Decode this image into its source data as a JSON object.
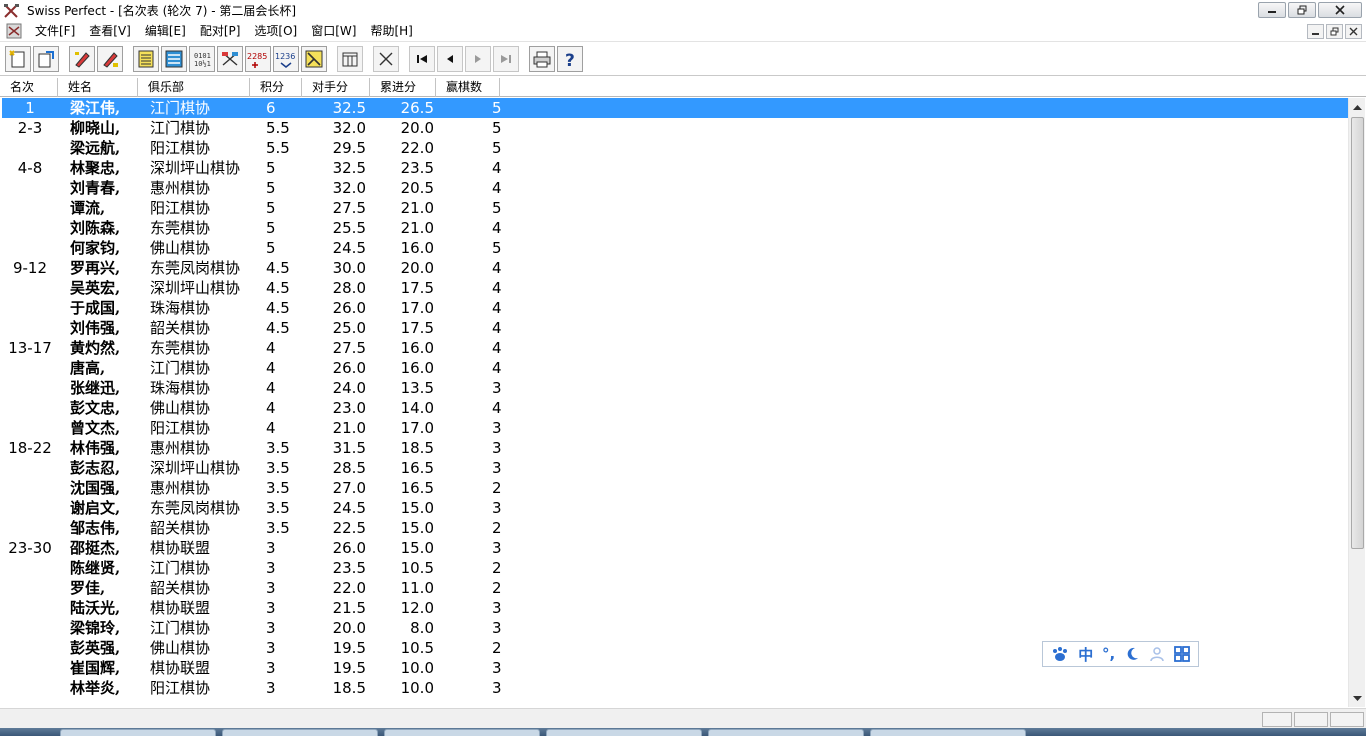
{
  "window": {
    "title": "Swiss Perfect - [名次表  (轮次 7) - 第二届会长杯]"
  },
  "menu": [
    {
      "label": "文件[F]"
    },
    {
      "label": "查看[V]"
    },
    {
      "label": "编辑[E]"
    },
    {
      "label": "配对[P]"
    },
    {
      "label": "选项[O]"
    },
    {
      "label": "窗口[W]"
    },
    {
      "label": "帮助[H]"
    }
  ],
  "toolbar": {
    "icons": [
      "new-file-icon",
      "open-file-icon",
      "pencil-icon",
      "pencil-alt-icon",
      "list-icon",
      "columns-icon",
      "binary-icon",
      "flags-icon",
      "number-2285-icon",
      "number-1236-icon",
      "puzzle-icon",
      "table-icon",
      "cross-pairing-icon",
      "first-round-icon",
      "prev-round-icon",
      "next-round-icon",
      "last-round-icon",
      "print-icon",
      "help-icon"
    ],
    "num_a": "2285",
    "num_b": "1236"
  },
  "columns": {
    "rank": "名次",
    "name": "姓名",
    "club": "俱乐部",
    "points": "积分",
    "opponent": "对手分",
    "cumulative": "累进分",
    "wins": "赢棋数"
  },
  "rows": [
    {
      "rank": "1",
      "name": "梁江伟,",
      "club": "江门棋协",
      "points": "6",
      "opp": "32.5",
      "cum": "26.5",
      "wins": "5"
    },
    {
      "rank": "2-3",
      "name": "柳晓山,",
      "club": "江门棋协",
      "points": "5.5",
      "opp": "32.0",
      "cum": "20.0",
      "wins": "5"
    },
    {
      "rank": "",
      "name": "梁远航,",
      "club": "阳江棋协",
      "points": "5.5",
      "opp": "29.5",
      "cum": "22.0",
      "wins": "5"
    },
    {
      "rank": "4-8",
      "name": "林聚忠,",
      "club": "深圳坪山棋协",
      "points": "5",
      "opp": "32.5",
      "cum": "23.5",
      "wins": "4"
    },
    {
      "rank": "",
      "name": "刘青春,",
      "club": "惠州棋协",
      "points": "5",
      "opp": "32.0",
      "cum": "20.5",
      "wins": "4"
    },
    {
      "rank": "",
      "name": "谭流,",
      "club": "阳江棋协",
      "points": "5",
      "opp": "27.5",
      "cum": "21.0",
      "wins": "5"
    },
    {
      "rank": "",
      "name": "刘陈森,",
      "club": "东莞棋协",
      "points": "5",
      "opp": "25.5",
      "cum": "21.0",
      "wins": "4"
    },
    {
      "rank": "",
      "name": "何家钧,",
      "club": "佛山棋协",
      "points": "5",
      "opp": "24.5",
      "cum": "16.0",
      "wins": "5"
    },
    {
      "rank": "9-12",
      "name": "罗再兴,",
      "club": "东莞凤岗棋协",
      "points": "4.5",
      "opp": "30.0",
      "cum": "20.0",
      "wins": "4"
    },
    {
      "rank": "",
      "name": "吴英宏,",
      "club": "深圳坪山棋协",
      "points": "4.5",
      "opp": "28.0",
      "cum": "17.5",
      "wins": "4"
    },
    {
      "rank": "",
      "name": "于成国,",
      "club": "珠海棋协",
      "points": "4.5",
      "opp": "26.0",
      "cum": "17.0",
      "wins": "4"
    },
    {
      "rank": "",
      "name": "刘伟强,",
      "club": "韶关棋协",
      "points": "4.5",
      "opp": "25.0",
      "cum": "17.5",
      "wins": "4"
    },
    {
      "rank": "13-17",
      "name": "黄灼然,",
      "club": "东莞棋协",
      "points": "4",
      "opp": "27.5",
      "cum": "16.0",
      "wins": "4"
    },
    {
      "rank": "",
      "name": "唐高,",
      "club": "江门棋协",
      "points": "4",
      "opp": "26.0",
      "cum": "16.0",
      "wins": "4"
    },
    {
      "rank": "",
      "name": "张继迅,",
      "club": "珠海棋协",
      "points": "4",
      "opp": "24.0",
      "cum": "13.5",
      "wins": "3"
    },
    {
      "rank": "",
      "name": "彭文忠,",
      "club": "佛山棋协",
      "points": "4",
      "opp": "23.0",
      "cum": "14.0",
      "wins": "4"
    },
    {
      "rank": "",
      "name": "曾文杰,",
      "club": "阳江棋协",
      "points": "4",
      "opp": "21.0",
      "cum": "17.0",
      "wins": "3"
    },
    {
      "rank": "18-22",
      "name": "林伟强,",
      "club": "惠州棋协",
      "points": "3.5",
      "opp": "31.5",
      "cum": "18.5",
      "wins": "3"
    },
    {
      "rank": "",
      "name": "彭志忍,",
      "club": "深圳坪山棋协",
      "points": "3.5",
      "opp": "28.5",
      "cum": "16.5",
      "wins": "3"
    },
    {
      "rank": "",
      "name": "沈国强,",
      "club": "惠州棋协",
      "points": "3.5",
      "opp": "27.0",
      "cum": "16.5",
      "wins": "2"
    },
    {
      "rank": "",
      "name": "谢启文,",
      "club": "东莞凤岗棋协",
      "points": "3.5",
      "opp": "24.5",
      "cum": "15.0",
      "wins": "3"
    },
    {
      "rank": "",
      "name": "邹志伟,",
      "club": "韶关棋协",
      "points": "3.5",
      "opp": "22.5",
      "cum": "15.0",
      "wins": "2"
    },
    {
      "rank": "23-30",
      "name": "邵挺杰,",
      "club": "棋协联盟",
      "points": "3",
      "opp": "26.0",
      "cum": "15.0",
      "wins": "3"
    },
    {
      "rank": "",
      "name": "陈继贤,",
      "club": "江门棋协",
      "points": "3",
      "opp": "23.5",
      "cum": "10.5",
      "wins": "2"
    },
    {
      "rank": "",
      "name": "罗佳,",
      "club": "韶关棋协",
      "points": "3",
      "opp": "22.0",
      "cum": "11.0",
      "wins": "2"
    },
    {
      "rank": "",
      "name": "陆沃光,",
      "club": "棋协联盟",
      "points": "3",
      "opp": "21.5",
      "cum": "12.0",
      "wins": "3"
    },
    {
      "rank": "",
      "name": "梁锦玲,",
      "club": "江门棋协",
      "points": "3",
      "opp": "20.0",
      "cum": "8.0",
      "wins": "3"
    },
    {
      "rank": "",
      "name": "彭英强,",
      "club": "佛山棋协",
      "points": "3",
      "opp": "19.5",
      "cum": "10.5",
      "wins": "2"
    },
    {
      "rank": "",
      "name": "崔国辉,",
      "club": "棋协联盟",
      "points": "3",
      "opp": "19.5",
      "cum": "10.0",
      "wins": "3"
    },
    {
      "rank": "",
      "name": "林举炎,",
      "club": "阳江棋协",
      "points": "3",
      "opp": "18.5",
      "cum": "10.0",
      "wins": "3"
    }
  ],
  "selected_row": 0,
  "ime": {
    "mode": "中",
    "punct": "°,",
    "symbols": [
      "paw-icon",
      "moon-icon",
      "user-icon",
      "grid-icon"
    ]
  },
  "colors": {
    "selection": "#3399ff",
    "ime_accent": "#2c6fd1"
  }
}
